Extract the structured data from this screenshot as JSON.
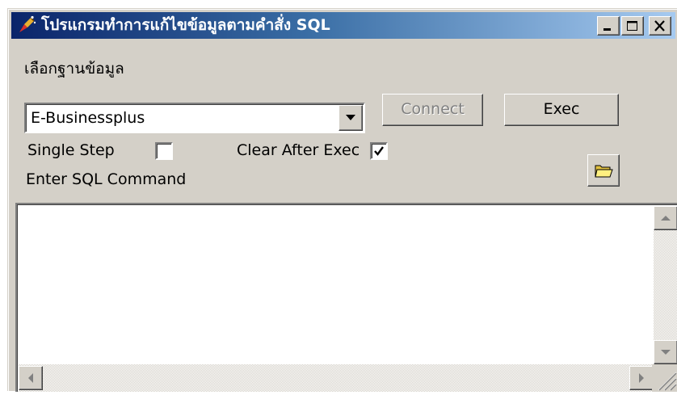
{
  "window": {
    "title": "โปรแกรมทำการแก้ไขข้อมูลตามคำสั่ง SQL",
    "icon": "sparkle-pen-icon"
  },
  "labels": {
    "select_database": "เลือกฐานข้อมูล",
    "single_step": "Single Step",
    "clear_after_exec": "Clear After Exec",
    "enter_sql": "Enter SQL Command"
  },
  "database_select": {
    "value": "E-Businessplus"
  },
  "buttons": {
    "connect": "Connect",
    "exec": "Exec",
    "open": "folder-open-icon"
  },
  "checkboxes": {
    "single_step_checked": false,
    "clear_after_exec_checked": true
  },
  "sql_editor": {
    "value": ""
  },
  "colors": {
    "title_start": "#0a246a",
    "title_end": "#a6caf0",
    "face": "#d4d0c8"
  }
}
